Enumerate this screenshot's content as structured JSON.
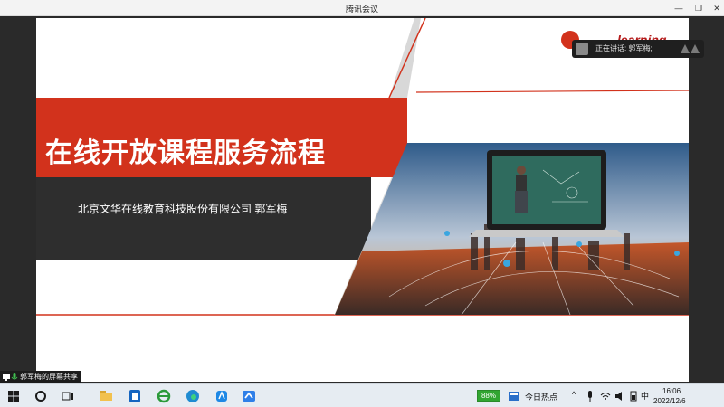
{
  "window": {
    "title": "腾讯会议"
  },
  "slide": {
    "title": "在线开放课程服务流程",
    "subtitle": "北京文华在线教育科技股份有限公司    郭军梅",
    "logo_text": "learning"
  },
  "speaking": {
    "text": "正在讲话: 郭军梅;"
  },
  "share": {
    "label": "郭军梅的屏幕共享"
  },
  "taskbar": {
    "battery": "88%",
    "news": "今日热点",
    "ime": "中",
    "time": "16:06",
    "date": "2022/12/6",
    "apps": [
      "start",
      "search",
      "task-view",
      "file-explorer",
      "app-blue-1",
      "edge-legacy",
      "edge",
      "app-blue-2",
      "tencent-meeting"
    ]
  },
  "colors": {
    "accent_red": "#d2321c",
    "dark_band": "#2e2e2e",
    "battery_green": "#31a531"
  }
}
